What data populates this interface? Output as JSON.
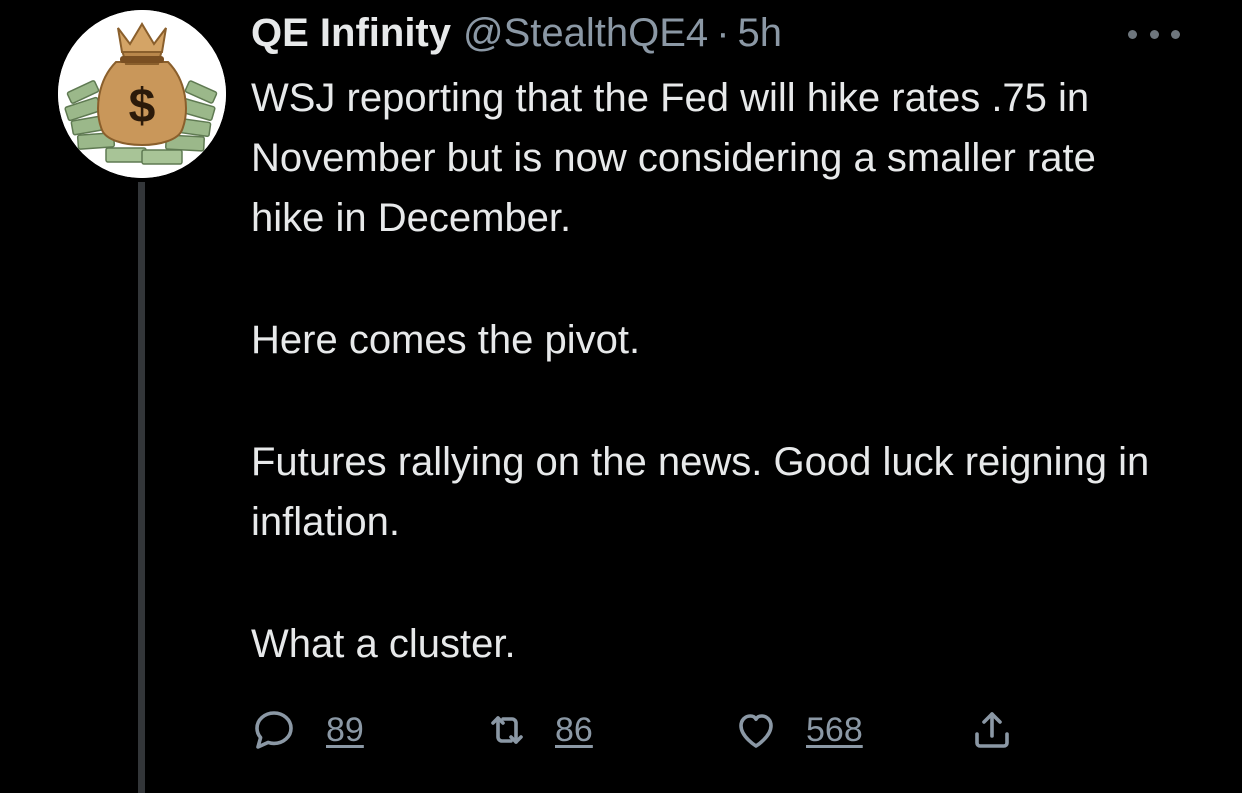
{
  "author": {
    "display_name": "QE Infinity",
    "handle": "@StealthQE4",
    "separator": "·",
    "time": "5h",
    "avatar_icon": "money-bag-icon"
  },
  "tweet": {
    "paragraphs": [
      "WSJ reporting that the Fed will hike rates .75 in November but is now considering a smaller rate hike in December.",
      "Here comes the pivot.",
      "Futures rallying on the news.  Good luck reigning in inflation.",
      "What a cluster."
    ]
  },
  "actions": {
    "reply": {
      "icon": "reply-icon",
      "count": "89"
    },
    "retweet": {
      "icon": "retweet-icon",
      "count": "86"
    },
    "like": {
      "icon": "heart-icon",
      "count": "568"
    },
    "share": {
      "icon": "share-icon"
    }
  },
  "colors": {
    "background": "#000000",
    "text_primary": "#e7e9ea",
    "text_secondary": "#8b98a5",
    "thread_line": "#333639"
  }
}
